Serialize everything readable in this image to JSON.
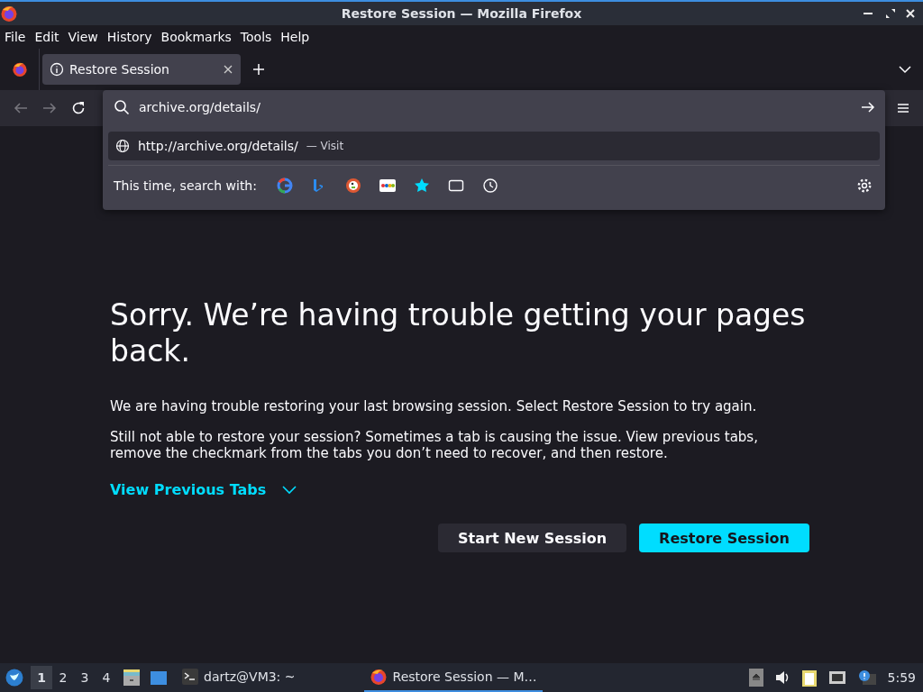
{
  "window": {
    "title": "Restore Session — Mozilla Firefox"
  },
  "menu": [
    "File",
    "Edit",
    "View",
    "History",
    "Bookmarks",
    "Tools",
    "Help"
  ],
  "tabs": [
    {
      "label": "Restore Session",
      "selected": true
    }
  ],
  "urlbar": {
    "value": "archive.org/details/",
    "suggestion": {
      "url": "http://archive.org/details/",
      "action": "— Visit"
    },
    "search_with_label": "This time, search with:"
  },
  "page": {
    "heading": "Sorry. We’re having trouble getting your pages back.",
    "paragraphs": [
      "We are having trouble restoring your last browsing session. Select Restore Session to try again.",
      "Still not able to restore your session? Sometimes a tab is causing the issue. View previous tabs, remove the checkmark from the tabs you don’t need to recover, and then restore."
    ],
    "toggle": "View Previous Tabs",
    "buttons": [
      {
        "label": "Start New Session",
        "kind": "secondary"
      },
      {
        "label": "Restore Session",
        "kind": "primary"
      }
    ]
  },
  "taskbar": {
    "workspaces": [
      {
        "label": "1",
        "selected": true
      },
      {
        "label": "2",
        "selected": false
      },
      {
        "label": "3",
        "selected": false
      },
      {
        "label": "4",
        "selected": false
      }
    ],
    "tasks": [
      {
        "label": "dartz@VM3: ~",
        "kind": "terminal",
        "selected": false
      },
      {
        "label": "Restore Session — M…",
        "kind": "browser",
        "selected": true
      }
    ],
    "clock": "5:59"
  }
}
